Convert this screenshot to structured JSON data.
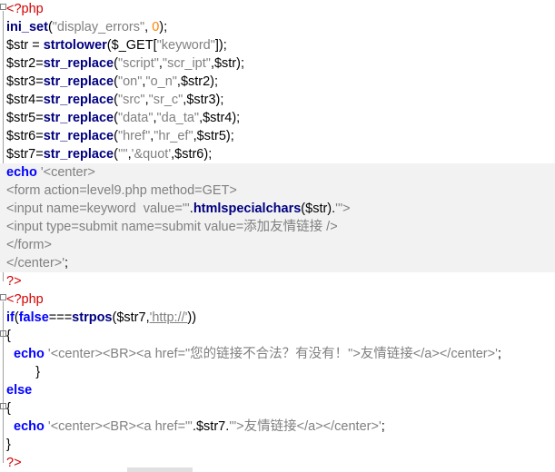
{
  "code_lines": [
    {
      "parts": [
        {
          "t": "<?php",
          "c": "php-tag"
        }
      ],
      "mark": true
    },
    {
      "parts": [
        {
          "t": "ini_set",
          "c": "fn"
        },
        {
          "t": "(",
          "c": "op"
        },
        {
          "t": "\"display_errors\"",
          "c": "str"
        },
        {
          "t": ", ",
          "c": "op"
        },
        {
          "t": "0",
          "c": "num"
        },
        {
          "t": ");",
          "c": "op"
        }
      ]
    },
    {
      "parts": [
        {
          "t": "$str",
          "c": "var"
        },
        {
          "t": " = ",
          "c": "op"
        },
        {
          "t": "strtolower",
          "c": "fn"
        },
        {
          "t": "(",
          "c": "op"
        },
        {
          "t": "$_GET",
          "c": "var"
        },
        {
          "t": "[",
          "c": "op"
        },
        {
          "t": "\"keyword\"",
          "c": "str"
        },
        {
          "t": "]);",
          "c": "op"
        }
      ]
    },
    {
      "parts": [
        {
          "t": "$str2",
          "c": "var"
        },
        {
          "t": "=",
          "c": "op"
        },
        {
          "t": "str_replace",
          "c": "fn"
        },
        {
          "t": "(",
          "c": "op"
        },
        {
          "t": "\"script\"",
          "c": "str"
        },
        {
          "t": ",",
          "c": "op"
        },
        {
          "t": "\"scr_ipt\"",
          "c": "str"
        },
        {
          "t": ",$str);",
          "c": "op"
        }
      ]
    },
    {
      "parts": [
        {
          "t": "$str3",
          "c": "var"
        },
        {
          "t": "=",
          "c": "op"
        },
        {
          "t": "str_replace",
          "c": "fn"
        },
        {
          "t": "(",
          "c": "op"
        },
        {
          "t": "\"on\"",
          "c": "str"
        },
        {
          "t": ",",
          "c": "op"
        },
        {
          "t": "\"o_n\"",
          "c": "str"
        },
        {
          "t": ",$str2);",
          "c": "op"
        }
      ]
    },
    {
      "parts": [
        {
          "t": "$str4",
          "c": "var"
        },
        {
          "t": "=",
          "c": "op"
        },
        {
          "t": "str_replace",
          "c": "fn"
        },
        {
          "t": "(",
          "c": "op"
        },
        {
          "t": "\"src\"",
          "c": "str"
        },
        {
          "t": ",",
          "c": "op"
        },
        {
          "t": "\"sr_c\"",
          "c": "str"
        },
        {
          "t": ",$str3);",
          "c": "op"
        }
      ]
    },
    {
      "parts": [
        {
          "t": "$str5",
          "c": "var"
        },
        {
          "t": "=",
          "c": "op"
        },
        {
          "t": "str_replace",
          "c": "fn"
        },
        {
          "t": "(",
          "c": "op"
        },
        {
          "t": "\"data\"",
          "c": "str"
        },
        {
          "t": ",",
          "c": "op"
        },
        {
          "t": "\"da_ta\"",
          "c": "str"
        },
        {
          "t": ",$str4);",
          "c": "op"
        }
      ]
    },
    {
      "parts": [
        {
          "t": "$str6",
          "c": "var"
        },
        {
          "t": "=",
          "c": "op"
        },
        {
          "t": "str_replace",
          "c": "fn"
        },
        {
          "t": "(",
          "c": "op"
        },
        {
          "t": "\"href\"",
          "c": "str"
        },
        {
          "t": ",",
          "c": "op"
        },
        {
          "t": "\"hr_ef\"",
          "c": "str"
        },
        {
          "t": ",$str5);",
          "c": "op"
        }
      ]
    },
    {
      "parts": [
        {
          "t": "$str7",
          "c": "var"
        },
        {
          "t": "=",
          "c": "op"
        },
        {
          "t": "str_replace",
          "c": "fn"
        },
        {
          "t": "(",
          "c": "op"
        },
        {
          "t": "'\"'",
          "c": "str"
        },
        {
          "t": ",",
          "c": "op"
        },
        {
          "t": "'&quot'",
          "c": "str"
        },
        {
          "t": ",$str6);",
          "c": "op"
        }
      ]
    },
    {
      "parts": [
        {
          "t": "echo",
          "c": "kw"
        },
        {
          "t": " '<center>",
          "c": "str"
        }
      ],
      "hl": true
    },
    {
      "parts": [
        {
          "t": "<form action=level9.php method=GET>",
          "c": "str"
        }
      ],
      "hl": true
    },
    {
      "parts": [
        {
          "t": "<input name=keyword  value=\"'",
          "c": "str"
        },
        {
          "t": ".",
          "c": "op"
        },
        {
          "t": "htmlspecialchars",
          "c": "fn"
        },
        {
          "t": "($str)",
          "c": "op"
        },
        {
          "t": ".",
          "c": "op"
        },
        {
          "t": "'\">",
          "c": "str"
        }
      ],
      "hl": true
    },
    {
      "parts": [
        {
          "t": "<input type=submit name=submit value=添加友情链接 />",
          "c": "str"
        }
      ],
      "hl": true
    },
    {
      "parts": [
        {
          "t": "</form>",
          "c": "str"
        }
      ],
      "hl": true
    },
    {
      "parts": [
        {
          "t": "</center>'",
          "c": "str"
        },
        {
          "t": ";",
          "c": "op"
        }
      ],
      "hl": true
    },
    {
      "parts": [
        {
          "t": "?>",
          "c": "php-tag"
        }
      ]
    },
    {
      "parts": [
        {
          "t": "<?php",
          "c": "php-tag"
        }
      ],
      "mark": true
    },
    {
      "parts": [
        {
          "t": "if",
          "c": "kw"
        },
        {
          "t": "(",
          "c": "op"
        },
        {
          "t": "false",
          "c": "kw"
        },
        {
          "t": "===",
          "c": "op"
        },
        {
          "t": "strpos",
          "c": "fn"
        },
        {
          "t": "($str7,",
          "c": "op"
        },
        {
          "t": "'http://'",
          "c": "str url"
        },
        {
          "t": "))",
          "c": "op"
        }
      ]
    },
    {
      "parts": [
        {
          "t": "{",
          "c": "op"
        }
      ],
      "mark": true
    },
    {
      "parts": [
        {
          "t": "  echo",
          "c": "kw"
        },
        {
          "t": " '<center><BR><a href=\"您的链接不合法？有没有！\">友情链接</a></center>'",
          "c": "str"
        },
        {
          "t": ";",
          "c": "op"
        }
      ]
    },
    {
      "parts": [
        {
          "t": "        }",
          "c": "op"
        }
      ]
    },
    {
      "parts": [
        {
          "t": "else",
          "c": "kw"
        }
      ]
    },
    {
      "parts": [
        {
          "t": "{",
          "c": "op"
        }
      ],
      "mark": true
    },
    {
      "parts": [
        {
          "t": "  echo",
          "c": "kw"
        },
        {
          "t": " '<center><BR><a href=\"'",
          "c": "str"
        },
        {
          "t": ".",
          "c": "op"
        },
        {
          "t": "$str7",
          "c": "var"
        },
        {
          "t": ".",
          "c": "op"
        },
        {
          "t": "'\">友情链接</a></center>'",
          "c": "str"
        },
        {
          "t": ";",
          "c": "op"
        }
      ]
    },
    {
      "parts": [
        {
          "t": "}",
          "c": "op"
        }
      ]
    },
    {
      "parts": [
        {
          "t": "?>",
          "c": "php-tag"
        }
      ]
    }
  ]
}
